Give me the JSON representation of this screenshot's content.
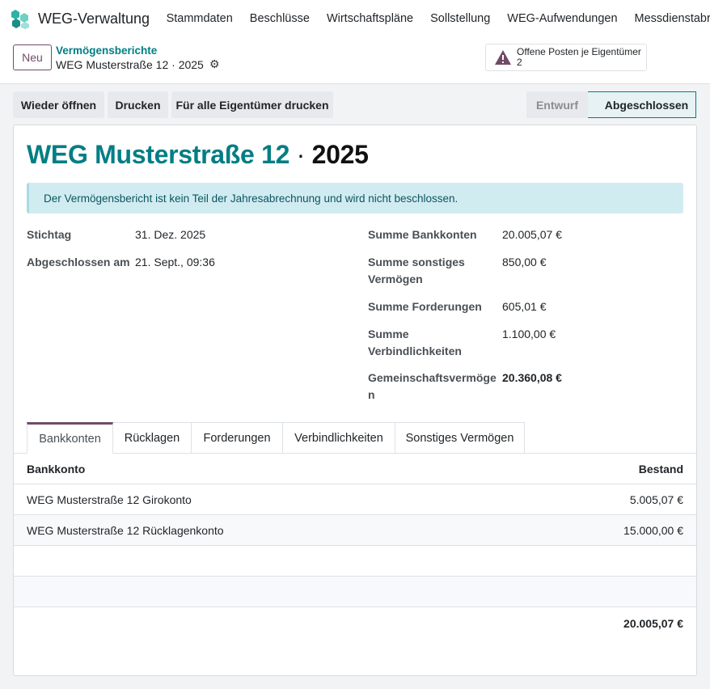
{
  "navbar": {
    "app_name": "WEG-Verwaltung",
    "menu": [
      "Stammdaten",
      "Beschlüsse",
      "Wirtschaftspläne",
      "Sollstellung",
      "WEG-Aufwendungen",
      "Messdienstabrechnu"
    ]
  },
  "control": {
    "new_label": "Neu",
    "breadcrumb_parent": "Vermögensberichte",
    "record_name": "WEG Musterstraße 12 · 2025",
    "alert_title": "Offene Posten je Eigentümer",
    "alert_count": "2"
  },
  "actions": {
    "reopen": "Wieder öffnen",
    "print": "Drucken",
    "print_all": "Für alle Eigentümer drucken"
  },
  "status": {
    "draft": "Entwurf",
    "done": "Abgeschlossen"
  },
  "form": {
    "title_name": "WEG Musterstraße 12",
    "title_sep": " · ",
    "title_year": "2025",
    "info": "Der Vermögensbericht ist kein Teil der Jahresabrechnung und wird nicht beschlossen.",
    "left": {
      "stichtag_label": "Stichtag",
      "stichtag_value": "31. Dez. 2025",
      "closed_label": "Abgeschlossen am",
      "closed_value": "21. Sept., 09:36"
    },
    "right": {
      "bank_label": "Summe Bankkonten",
      "bank_value": "20.005,07 €",
      "other_label_1": "Summe sonstiges",
      "other_label_2": "Vermögen",
      "other_value": "850,00 €",
      "claims_label": "Summe Forderungen",
      "claims_value": "605,01 €",
      "liab_label_1": "Summe",
      "liab_label_2": "Verbindlichkeiten",
      "liab_value": "1.100,00 €",
      "assets_label_1": "Gemeinschaftsvermöge",
      "assets_label_2": "n",
      "assets_value": "20.360,08 €"
    }
  },
  "tabs": [
    "Bankkonten",
    "Rücklagen",
    "Forderungen",
    "Verbindlichkeiten",
    "Sonstiges Vermögen"
  ],
  "table": {
    "col_account": "Bankkonto",
    "col_balance": "Bestand",
    "rows": [
      {
        "account": "WEG Musterstraße 12 Girokonto",
        "balance": "5.005,07 €"
      },
      {
        "account": "WEG Musterstraße 12 Rücklagenkonto",
        "balance": "15.000,00 €"
      }
    ],
    "total": "20.005,07 €"
  }
}
